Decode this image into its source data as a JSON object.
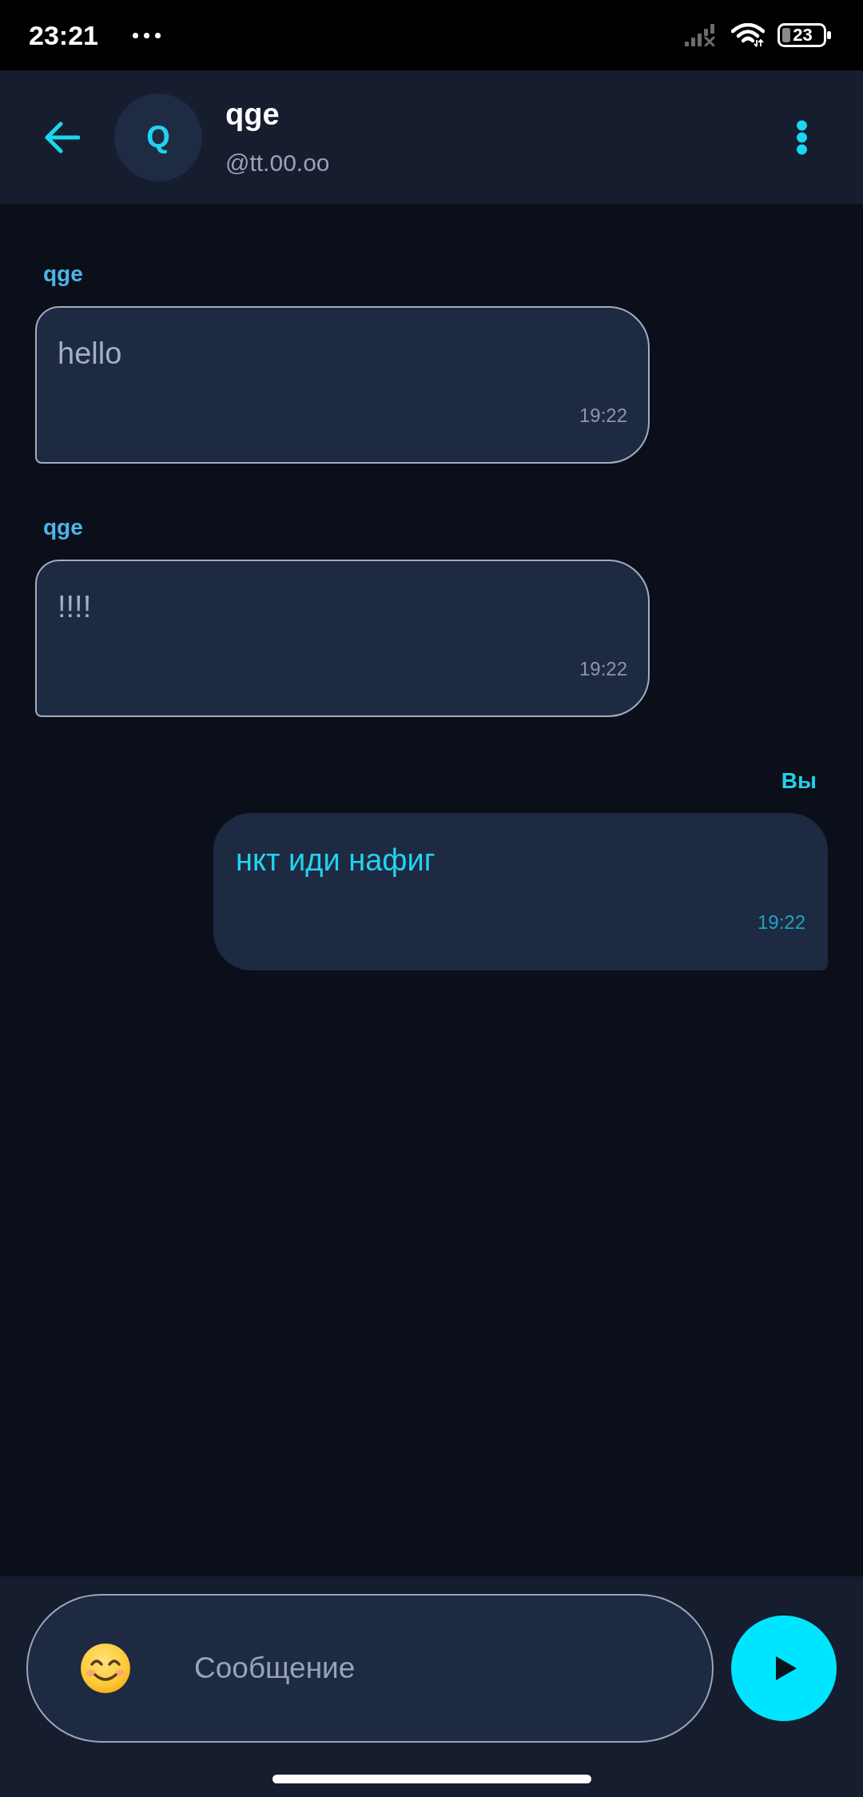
{
  "status_bar": {
    "time": "23:21",
    "battery": "23"
  },
  "header": {
    "avatar_letter": "Q",
    "name": "qge",
    "handle": "@tt.00.oo"
  },
  "messages": [
    {
      "kind": "incoming",
      "sender": "qge",
      "text": "hello",
      "time": "19:22"
    },
    {
      "kind": "incoming",
      "sender": "qge",
      "text": "!!!!",
      "time": "19:22"
    },
    {
      "kind": "outgoing",
      "sender": "Вы",
      "text": "нкт иди нафиг",
      "time": "19:22"
    }
  ],
  "composer": {
    "placeholder": "Сообщение"
  }
}
